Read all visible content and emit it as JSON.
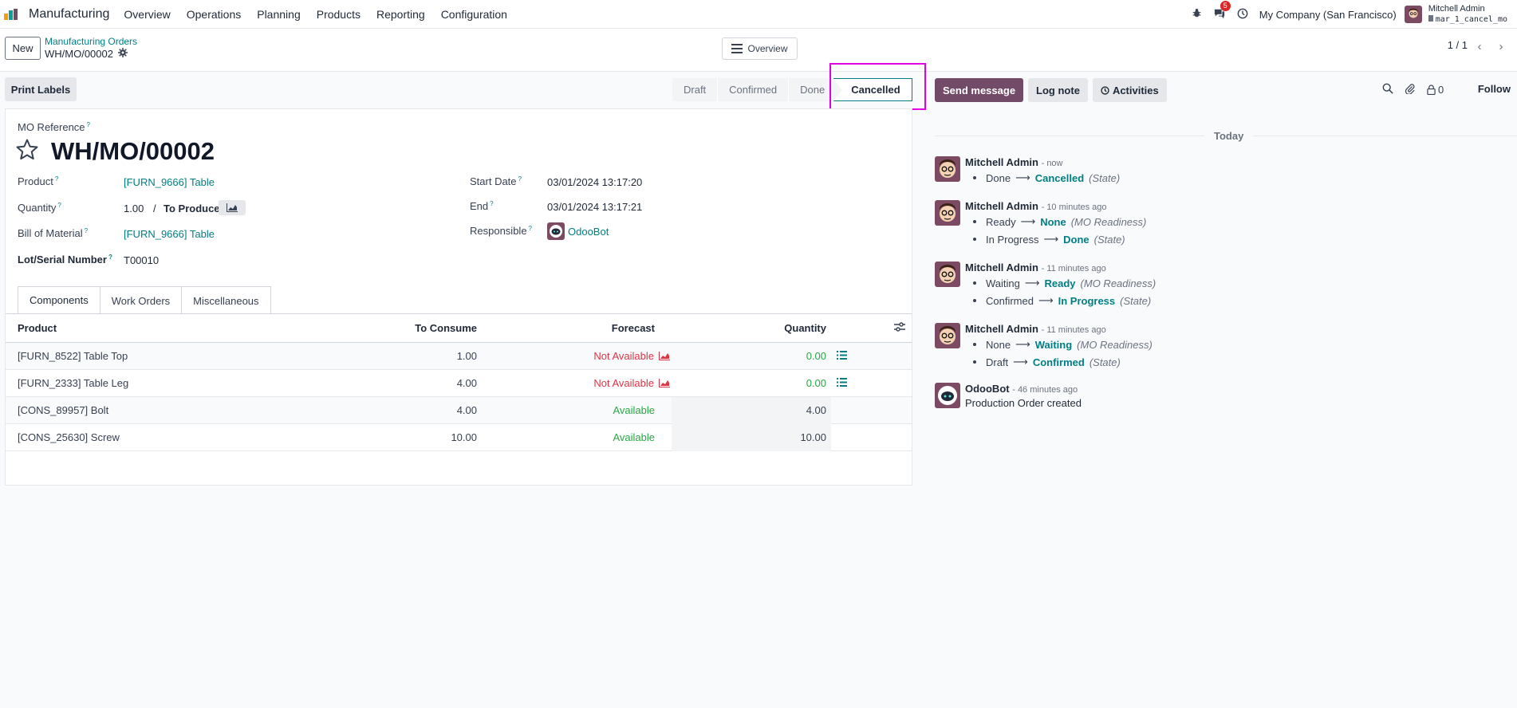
{
  "navbar": {
    "app_name": "Manufacturing",
    "menus": [
      "Overview",
      "Operations",
      "Planning",
      "Products",
      "Reporting",
      "Configuration"
    ],
    "messages_badge": "5",
    "company": "My Company (San Francisco)",
    "user_name": "Mitchell Admin",
    "db_name": "mar_1_cancel_mo"
  },
  "control": {
    "new_label": "New",
    "breadcrumb_parent": "Manufacturing Orders",
    "breadcrumb_current": "WH/MO/00002",
    "overview_label": "Overview",
    "pager": "1 / 1"
  },
  "actions": {
    "print_labels": "Print Labels"
  },
  "status": {
    "stages": [
      "Draft",
      "Confirmed",
      "Done"
    ],
    "current": "Cancelled"
  },
  "form": {
    "ref_label": "MO Reference",
    "title": "WH/MO/00002",
    "product_label": "Product",
    "product_value": "[FURN_9666] Table",
    "quantity_label": "Quantity",
    "quantity_value": "1.00",
    "to_produce": "To Produce",
    "bom_label": "Bill of Material",
    "bom_value": "[FURN_9666] Table",
    "lot_label": "Lot/Serial Number",
    "lot_value": "T00010",
    "start_label": "Start Date",
    "start_value": "03/01/2024 13:17:20",
    "end_label": "End",
    "end_value": "03/01/2024 13:17:21",
    "responsible_label": "Responsible",
    "responsible_value": "OdooBot",
    "question_mark": "?"
  },
  "tabs": [
    "Components",
    "Work Orders",
    "Miscellaneous"
  ],
  "components": {
    "headers": {
      "product": "Product",
      "to_consume": "To Consume",
      "forecast": "Forecast",
      "quantity": "Quantity"
    },
    "rows": [
      {
        "product": "[FURN_8522] Table Top",
        "to_consume": "1.00",
        "forecast": "Not Available",
        "quantity": "0.00"
      },
      {
        "product": "[FURN_2333] Table Leg",
        "to_consume": "4.00",
        "forecast": "Not Available",
        "quantity": "0.00"
      },
      {
        "product": "[CONS_89957] Bolt",
        "to_consume": "4.00",
        "forecast": "Available",
        "quantity": "4.00"
      },
      {
        "product": "[CONS_25630] Screw",
        "to_consume": "10.00",
        "forecast": "Available",
        "quantity": "10.00"
      }
    ]
  },
  "chatter": {
    "send_message": "Send message",
    "log_note": "Log note",
    "activities": "Activities",
    "followers_count": "0",
    "follow": "Follow",
    "today": "Today",
    "arrow": "⟶",
    "messages": [
      {
        "author": "Mitchell Admin",
        "date": "- now",
        "lines": [
          {
            "old": "Done",
            "new": "Cancelled",
            "field": "(State)"
          }
        ]
      },
      {
        "author": "Mitchell Admin",
        "date": "- 10 minutes ago",
        "lines": [
          {
            "old": "Ready",
            "new": "None",
            "field": "(MO Readiness)"
          },
          {
            "old": "In Progress",
            "new": "Done",
            "field": "(State)"
          }
        ]
      },
      {
        "author": "Mitchell Admin",
        "date": "- 11 minutes ago",
        "lines": [
          {
            "old": "Waiting",
            "new": "Ready",
            "field": "(MO Readiness)"
          },
          {
            "old": "Confirmed",
            "new": "In Progress",
            "field": "(State)"
          }
        ]
      },
      {
        "author": "Mitchell Admin",
        "date": "- 11 minutes ago",
        "lines": [
          {
            "old": "None",
            "new": "Waiting",
            "field": "(MO Readiness)"
          },
          {
            "old": "Draft",
            "new": "Confirmed",
            "field": "(State)"
          }
        ]
      },
      {
        "author": "OdooBot",
        "date": "- 46 minutes ago",
        "text": "Production Order created"
      }
    ]
  },
  "colors": {
    "accent": "#017e84",
    "brand": "#714b67",
    "danger": "#dc3545",
    "success": "#28a745",
    "highlight": "#e000e0"
  }
}
